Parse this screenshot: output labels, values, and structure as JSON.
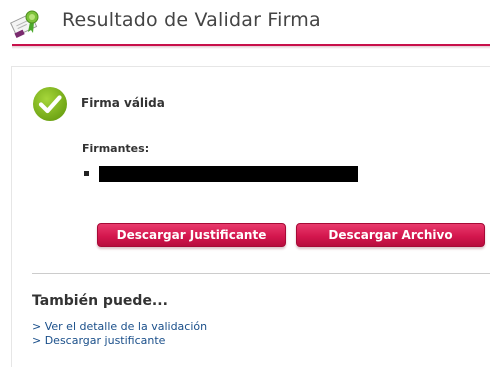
{
  "header": {
    "title": "Resultado de Validar Firma",
    "icon": "certificate-ribbon-icon"
  },
  "result": {
    "status": "Firma válida",
    "status_icon": "check-circle-icon",
    "signers_label": "Firmantes:",
    "signers": [
      "[redacted]"
    ]
  },
  "actions": {
    "download_receipt": "Descargar Justificante",
    "download_file": "Descargar Archivo"
  },
  "also": {
    "title": "También puede...",
    "links": [
      "> Ver el detalle de la validación",
      "> Descargar justificante"
    ]
  },
  "colors": {
    "accent": "#c8104a",
    "success": "#7cb319",
    "link": "#1a4f8a"
  }
}
